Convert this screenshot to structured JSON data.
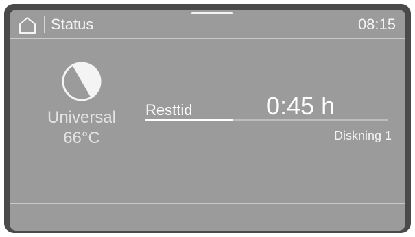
{
  "header": {
    "home_icon": "home-icon",
    "title": "Status",
    "time": "08:15"
  },
  "program": {
    "icon": "program-universal-icon",
    "name": "Universal",
    "temperature": "66°C"
  },
  "remaining": {
    "label": "Resttid",
    "value": "0:45 h",
    "progress_fraction": 0.36
  },
  "phase": "Diskning 1",
  "colors": {
    "bezel": "#4a4a4a",
    "screen": "#9b9b9b",
    "text": "#ffffff"
  }
}
